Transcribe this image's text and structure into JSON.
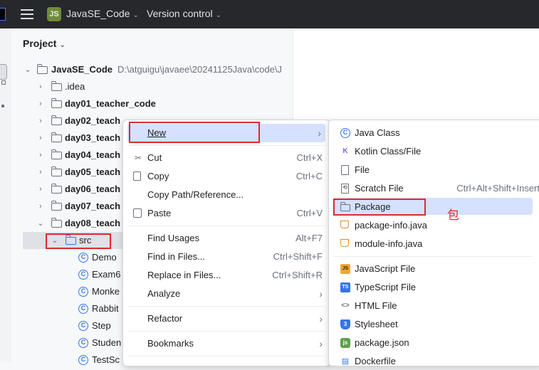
{
  "titlebar": {
    "project_badge": "JS",
    "project_name": "JavaSE_Code",
    "vcs_label": "Version control"
  },
  "project_panel": {
    "title": "Project",
    "root": {
      "name": "JavaSE_Code",
      "path": "D:\\atguigu\\javaee\\20241125Java\\code\\J"
    },
    "items": [
      {
        "label": ".idea"
      },
      {
        "label": "day01_teacher_code"
      },
      {
        "label": "day02_teach"
      },
      {
        "label": "day03_teach"
      },
      {
        "label": "day04_teach"
      },
      {
        "label": "day05_teach"
      },
      {
        "label": "day06_teach"
      },
      {
        "label": "day07_teach"
      },
      {
        "label": "day08_teach"
      },
      {
        "label": "src"
      },
      {
        "label": "Demo"
      },
      {
        "label": "Exam6"
      },
      {
        "label": "Monke"
      },
      {
        "label": "Rabbit"
      },
      {
        "label": "Step"
      },
      {
        "label": "Studen"
      },
      {
        "label": "TestSc"
      }
    ]
  },
  "context_menu": {
    "items": [
      {
        "label": "New",
        "shortcut": ""
      },
      {
        "label": "Cut",
        "shortcut": "Ctrl+X"
      },
      {
        "label": "Copy",
        "shortcut": "Ctrl+C"
      },
      {
        "label": "Copy Path/Reference...",
        "shortcut": ""
      },
      {
        "label": "Paste",
        "shortcut": "Ctrl+V"
      },
      {
        "label": "Find Usages",
        "shortcut": "Alt+F7"
      },
      {
        "label": "Find in Files...",
        "shortcut": "Ctrl+Shift+F"
      },
      {
        "label": "Replace in Files...",
        "shortcut": "Ctrl+Shift+R"
      },
      {
        "label": "Analyze",
        "shortcut": ""
      },
      {
        "label": "Refactor",
        "shortcut": ""
      },
      {
        "label": "Bookmarks",
        "shortcut": ""
      }
    ]
  },
  "new_submenu": {
    "items": [
      {
        "label": "Java Class",
        "shortcut": "",
        "icon": "java-class-icon"
      },
      {
        "label": "Kotlin Class/File",
        "shortcut": "",
        "icon": "kotlin-icon"
      },
      {
        "label": "File",
        "shortcut": "",
        "icon": "file-icon"
      },
      {
        "label": "Scratch File",
        "shortcut": "Ctrl+Alt+Shift+Insert",
        "icon": "scratch-file-icon"
      },
      {
        "label": "Package",
        "shortcut": "",
        "icon": "package-icon"
      },
      {
        "label": "package-info.java",
        "shortcut": "",
        "icon": "java-file-icon"
      },
      {
        "label": "module-info.java",
        "shortcut": "",
        "icon": "java-file-icon"
      },
      {
        "label": "JavaScript File",
        "shortcut": "",
        "icon": "javascript-icon"
      },
      {
        "label": "TypeScript File",
        "shortcut": "",
        "icon": "typescript-icon"
      },
      {
        "label": "HTML File",
        "shortcut": "",
        "icon": "html-icon"
      },
      {
        "label": "Stylesheet",
        "shortcut": "",
        "icon": "css-icon"
      },
      {
        "label": "package.json",
        "shortcut": "",
        "icon": "nodejs-icon"
      },
      {
        "label": "Dockerfile",
        "shortcut": "",
        "icon": "docker-icon"
      }
    ]
  },
  "annotation": {
    "text": "包"
  },
  "colors": {
    "accent": "#3574f0",
    "highlight": "#d5e1ff",
    "annotation_red": "#e0282e",
    "titlebar": "#27282c"
  }
}
